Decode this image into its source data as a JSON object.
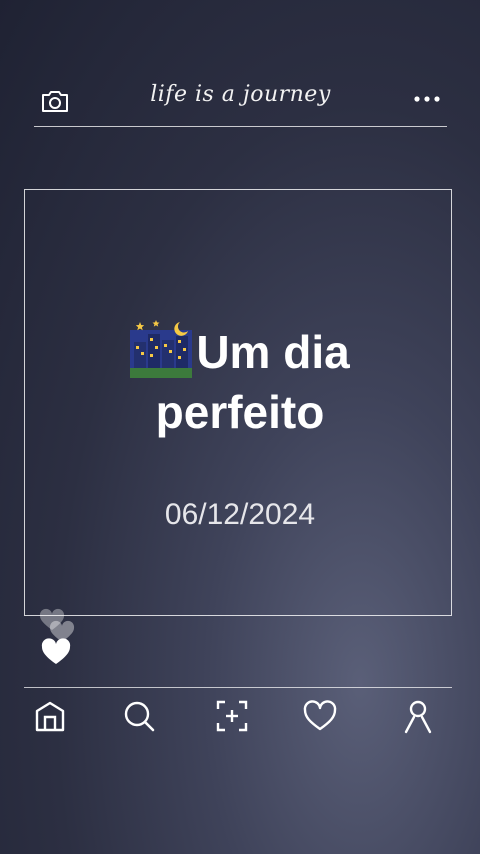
{
  "header": {
    "title": "life is a journey",
    "camera_icon": "camera-icon",
    "more_icon": "more-dots-icon"
  },
  "card": {
    "headline_line1": "Um dia",
    "headline_line2": "perfeito",
    "emoji": "night-city-emoji",
    "date": "06/12/2024"
  },
  "decor": {
    "hearts_icon": "hearts-icon"
  },
  "nav": {
    "items": [
      {
        "icon": "home-icon"
      },
      {
        "icon": "search-icon"
      },
      {
        "icon": "add-post-icon"
      },
      {
        "icon": "heart-icon"
      },
      {
        "icon": "profile-icon"
      }
    ]
  },
  "colors": {
    "background": "#2c2f42",
    "foreground": "#ffffff"
  }
}
